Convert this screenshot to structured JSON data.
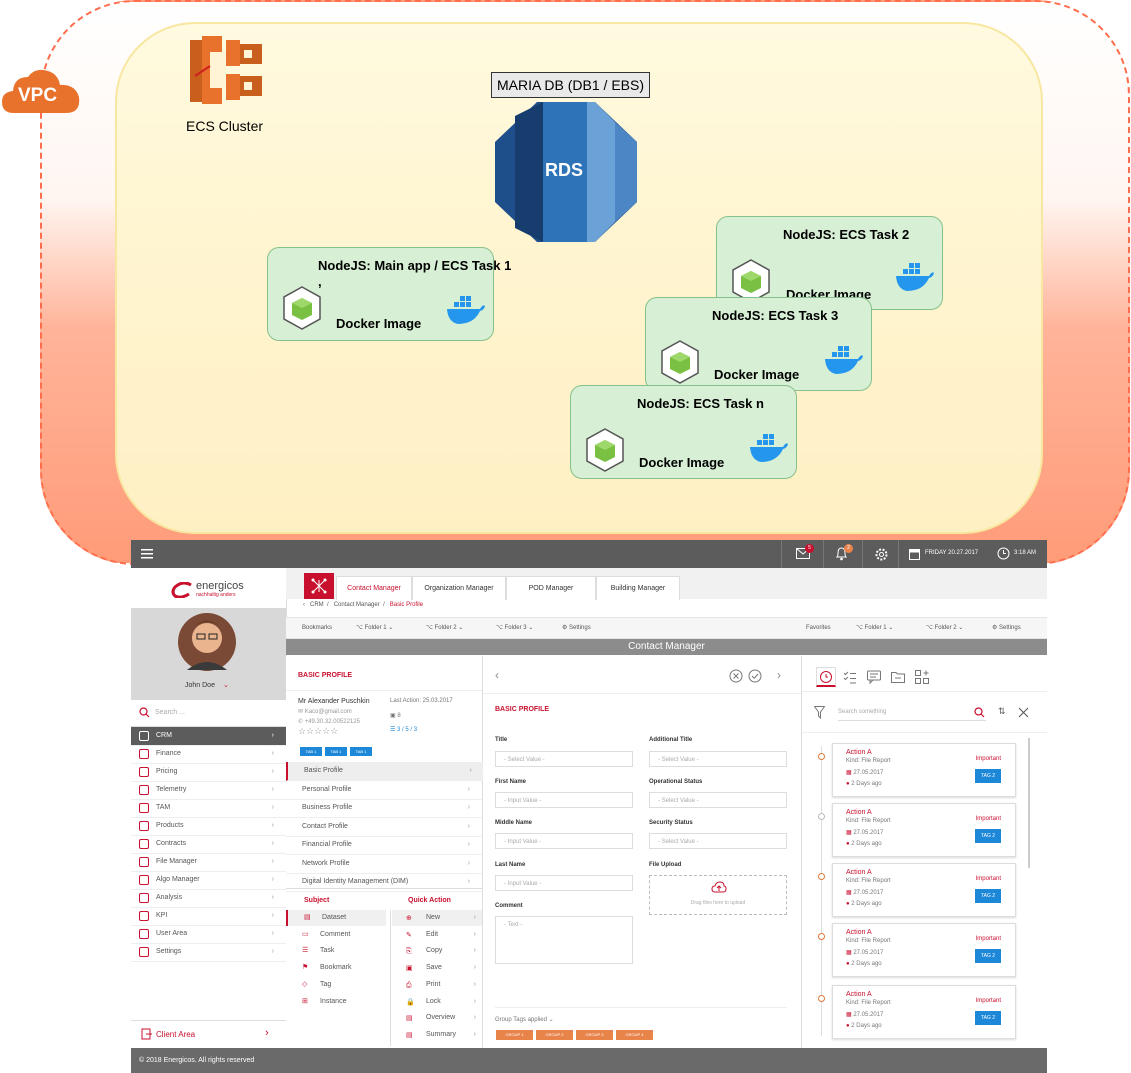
{
  "diagram": {
    "vpc_label": "VPC",
    "ecs_cluster_label": "ECS Cluster",
    "db_label": "MARIA DB (DB1 / EBS)",
    "rds_label": "RDS",
    "nodes": [
      {
        "title": "NodeJS: Main app / ECS Task 1",
        "extra": ",",
        "image": "Docker Image"
      },
      {
        "title": "NodeJS: ECS Task 2",
        "image": "Docker Image"
      },
      {
        "title": "NodeJS: ECS Task 3",
        "image": "Docker Image"
      },
      {
        "title": "NodeJS: ECS Task n",
        "image": "Docker Image"
      }
    ],
    "colors": {
      "vpc_border": "#ff6d4d",
      "cluster_fill": "#fff5d1",
      "node_fill": "#d7efd4",
      "ecs_orange": "#e8722b",
      "rds_blue": "#2e73b8"
    }
  },
  "app": {
    "topbar": {
      "mail_count": "5",
      "bell_count": "2",
      "date": "FRIDAY 20.27.2017",
      "time": "3:18 AM"
    },
    "logo": {
      "name": "energicos",
      "tagline": "nachhaltig anders"
    },
    "user_name": "John Doe",
    "search_placeholder": "Search ...",
    "menu": [
      "CRM",
      "Finance",
      "Pricing",
      "Telemetry",
      "TAM",
      "Products",
      "Contracts",
      "File Manager",
      "Algo Manager",
      "Analysis",
      "KPI",
      "User Area",
      "Settings"
    ],
    "client_area": "Client Area",
    "footer": "© 2018 Energicos. All rights reserved",
    "tabs": [
      "Contact Manager",
      "Organization Manager",
      "POD Manager",
      "Building Manager"
    ],
    "breadcrumb": [
      "CRM",
      "Contact Manager",
      "Basic Profile"
    ],
    "bookmarks_label": "Bookmarks",
    "bookmark_folders": [
      "Folder 1",
      "Folder 2",
      "Folder 3"
    ],
    "bookmarks_settings": "Settings",
    "favorites_label": "Favorites",
    "favorite_folders": [
      "Folder 1",
      "Folder 2"
    ],
    "favorites_settings": "Settings",
    "page_title": "Contact Manager",
    "profile": {
      "section_title": "BASIC PROFILE",
      "name": "Mr Alexander Puschkin",
      "email": "Kaco@gmail.com",
      "phone": "+49.30.32.00522125",
      "last_action": "Last Action: 25.03.2017",
      "count": "8",
      "ratio": "3 / 5 / 3",
      "tags": [
        "TAB 1",
        "TAB 1",
        "TAB 1"
      ],
      "items": [
        "Basic Profile",
        "Personal Profile",
        "Business Profile",
        "Contact Profile",
        "Financial Profile",
        "Network Profile",
        "Digital Identity Management (DIM)"
      ]
    },
    "subject": {
      "header": "Subject",
      "items": [
        "Dataset",
        "Comment",
        "Task",
        "Bookmark",
        "Tag",
        "Instance"
      ]
    },
    "quick_action": {
      "header": "Quick Action",
      "items": [
        "New",
        "Edit",
        "Copy",
        "Save",
        "Print",
        "Lock",
        "Overview",
        "Summary"
      ]
    },
    "form": {
      "title": "BASIC PROFILE",
      "title_label": "Title",
      "title_value": "- Select Value -",
      "additional_title_label": "Additional Title",
      "additional_title_value": "- Select Value -",
      "first_name_label": "First Name",
      "first_name_value": "- Input Value -",
      "operational_status_label": "Operational Status",
      "operational_status_value": "- Select Value -",
      "middle_name_label": "Middle Name",
      "middle_name_value": "- Input Value -",
      "security_status_label": "Security Status",
      "security_status_value": "- Select Value -",
      "last_name_label": "Last Name",
      "last_name_value": "- Input Value -",
      "file_upload_label": "File Upload",
      "file_upload_hint": "Drag files here to upload",
      "comment_label": "Comment",
      "comment_value": "- Text -",
      "group_tags_label": "Group Tags applied",
      "group_tags": [
        "GROUP 1",
        "GROUP 2",
        "GROUP 3",
        "GROUP 4"
      ]
    },
    "activity": {
      "search_placeholder": "Search something",
      "cards": [
        {
          "title": "Action A",
          "kind": "Kind: File Report",
          "date": "27.05.2017",
          "ago": "2 Days ago",
          "priority": "Important",
          "tag": "TAG 2"
        },
        {
          "title": "Action A",
          "kind": "Kind: File Report",
          "date": "27.05.2017",
          "ago": "2 Days ago",
          "priority": "Important",
          "tag": "TAG 2"
        },
        {
          "title": "Action A",
          "kind": "Kind: File Report",
          "date": "27.05.2017",
          "ago": "2 Days ago",
          "priority": "Important",
          "tag": "TAG 2"
        },
        {
          "title": "Action A",
          "kind": "Kind: File Report",
          "date": "27.05.2017",
          "ago": "2 Days ago",
          "priority": "Important",
          "tag": "TAG 2"
        },
        {
          "title": "Action A",
          "kind": "Kind: File Report",
          "date": "27.05.2017",
          "ago": "2 Days ago",
          "priority": "Important",
          "tag": "TAG 2"
        }
      ]
    }
  }
}
